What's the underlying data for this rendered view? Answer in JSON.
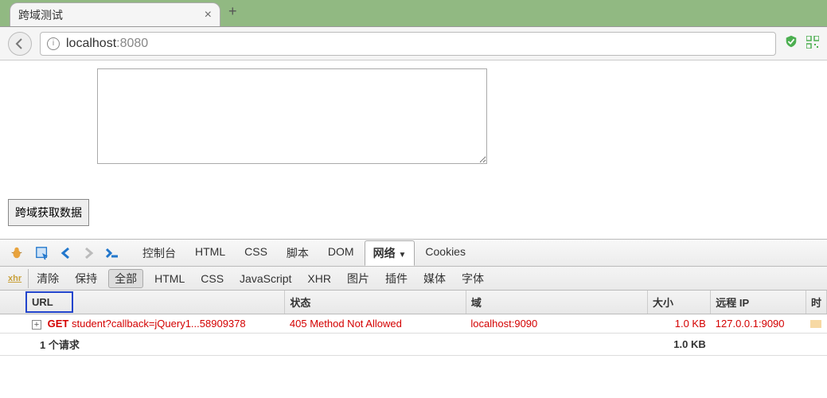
{
  "tab": {
    "title": "跨域测试"
  },
  "address": {
    "host": "localhost",
    "port": ":8080"
  },
  "page": {
    "button_label": "跨域获取数据",
    "textarea_value": ""
  },
  "devtools": {
    "tabs": {
      "console": "控制台",
      "html": "HTML",
      "css": "CSS",
      "script": "脚本",
      "dom": "DOM",
      "network": "网络",
      "cookies": "Cookies"
    },
    "filters": {
      "xhr_label": "xhr",
      "clear": "清除",
      "persist": "保持",
      "all": "全部",
      "html": "HTML",
      "css": "CSS",
      "javascript": "JavaScript",
      "xhr": "XHR",
      "image": "图片",
      "plugin": "插件",
      "media": "媒体",
      "font": "字体"
    },
    "columns": {
      "url": "URL",
      "status": "状态",
      "domain": "域",
      "size": "大小",
      "remote_ip": "远程 IP",
      "time": "时"
    },
    "requests": [
      {
        "method": "GET",
        "url": "student?callback=jQuery1...58909378",
        "status": "405 Method Not Allowed",
        "domain": "localhost:9090",
        "size": "1.0 KB",
        "remote_ip": "127.0.0.1:9090"
      }
    ],
    "summary": {
      "label": "1 个请求",
      "size": "1.0 KB"
    }
  }
}
